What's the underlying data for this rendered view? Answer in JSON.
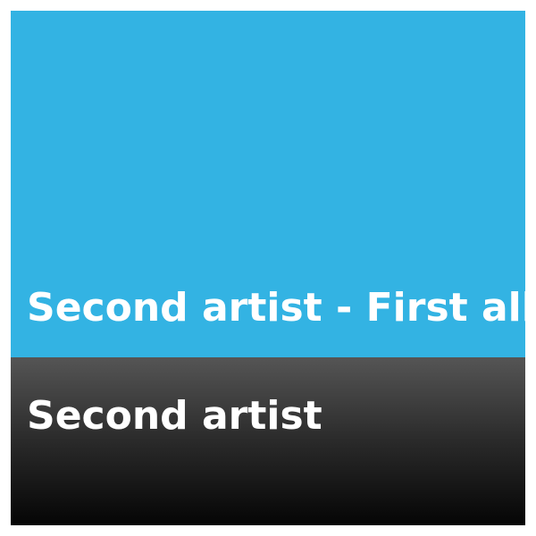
{
  "album_tile": {
    "title": "Second artist - First album",
    "background_color": "#33b3e3"
  },
  "artist_tile": {
    "name": "Second artist"
  }
}
